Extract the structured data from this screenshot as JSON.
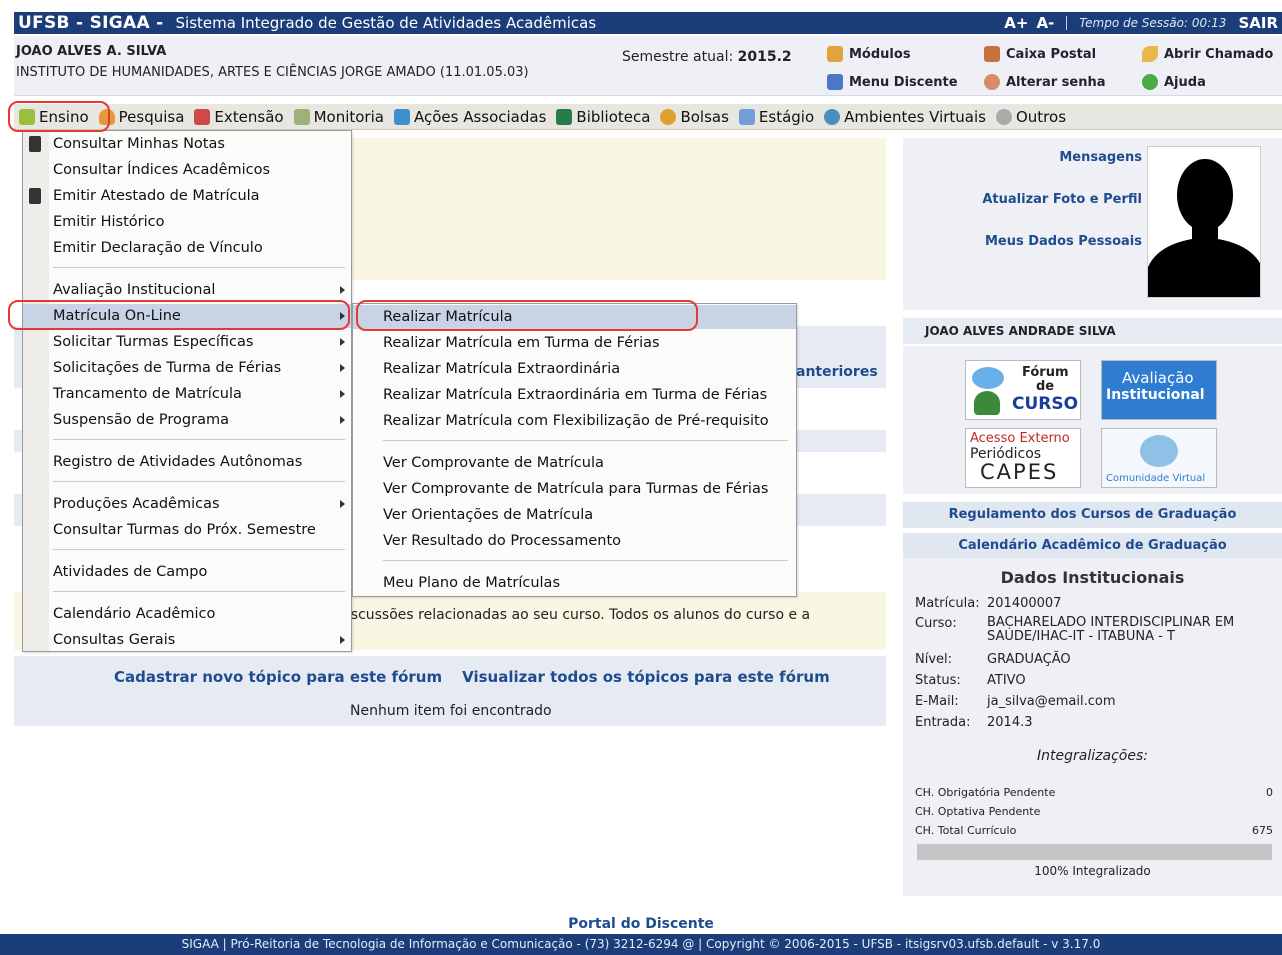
{
  "topbar": {
    "brand": "UFSB - SIGAA -",
    "system_name": "Sistema Integrado de Gestão de Atividades Acadêmicas",
    "font_increase": "A+",
    "font_decrease": "A-",
    "session_label": "Tempo de Sessão: 00:13",
    "logout": "SAIR"
  },
  "user": {
    "name": "JOAO ALVES A. SILVA",
    "institute": "INSTITUTO DE HUMANIDADES, ARTES E CIÊNCIAS JORGE AMADO (11.01.05.03)",
    "semester_label": "Semestre atual:",
    "semester_value": "2015.2"
  },
  "quicklinks": {
    "modulos": "Módulos",
    "caixa_postal": "Caixa Postal",
    "abrir_chamado": "Abrir Chamado",
    "menu_discente": "Menu Discente",
    "alterar_senha": "Alterar senha",
    "ajuda": "Ajuda"
  },
  "menubar": [
    "Ensino",
    "Pesquisa",
    "Extensão",
    "Monitoria",
    "Ações Associadas",
    "Biblioteca",
    "Bolsas",
    "Estágio",
    "Ambientes Virtuais",
    "Outros"
  ],
  "ensino_menu": [
    "Consultar Minhas Notas",
    "Consultar Índices Acadêmicos",
    "Emitir Atestado de Matrícula",
    "Emitir Histórico",
    "Emitir Declaração de Vínculo",
    "Avaliação Institucional",
    "Matrícula On-Line",
    "Solicitar Turmas Específicas",
    "Solicitações de Turma de Férias",
    "Trancamento de Matrícula",
    "Suspensão de Programa",
    "Registro de Atividades Autônomas",
    "Produções Acadêmicas",
    "Consultar Turmas do Próx. Semestre",
    "Atividades de Campo",
    "Calendário Acadêmico",
    "Consultas Gerais"
  ],
  "matricula_menu": [
    "Realizar Matrícula",
    "Realizar Matrícula em Turma de Férias",
    "Realizar Matrícula Extraordinária",
    "Realizar Matrícula Extraordinária em Turma de Férias",
    "Realizar Matrícula com Flexibilização de Pré-requisito",
    "Ver Comprovante de Matrícula",
    "Ver Comprovante de Matrícula para Turmas de Férias",
    "Ver Orientações de Matrícula",
    "Ver Resultado do Processamento",
    "Meu Plano de Matrículas"
  ],
  "main": {
    "anteriores": "anteriores",
    "forum_text": "discussões relacionadas ao seu curso. Todos os alunos do curso e a",
    "new_topic": "Cadastrar novo tópico para este fórum",
    "all_topics": "Visualizar todos os tópicos para este fórum",
    "empty": "Nenhum item foi encontrado"
  },
  "sidebar": {
    "mensagens": "Mensagens",
    "atualizar_foto": "Atualizar Foto e Perfil",
    "dados_pessoais": "Meus Dados Pessoais",
    "full_name": "JOAO ALVES ANDRADE SILVA",
    "tiles": {
      "forum_line1": "Fórum",
      "forum_line2": "de",
      "forum_line3": "CURSO",
      "avaliacao_line1": "Avaliação",
      "avaliacao_line2": "Institucional",
      "capes_line1": "Acesso Externo",
      "capes_line2": "Periódicos",
      "capes_line3": "CAPES",
      "comunidade": "Comunidade Virtual"
    },
    "regulamento": "Regulamento dos Cursos de Graduação",
    "calendario": "Calendário Acadêmico de Graduação",
    "dados_title": "Dados Institucionais",
    "matricula_k": "Matrícula:",
    "matricula_v": "201400007",
    "curso_k": "Curso:",
    "curso_v1": "BACHARELADO INTERDISCIPLINAR EM",
    "curso_v2": "SAÚDE/IHAC-IT - ITABUNA - T",
    "nivel_k": "Nível:",
    "nivel_v": "GRADUAÇÃO",
    "status_k": "Status:",
    "status_v": "ATIVO",
    "email_k": "E-Mail:",
    "email_v": "ja_silva@email.com",
    "entrada_k": "Entrada:",
    "entrada_v": "2014.3",
    "integralizacoes": "Integralizações:",
    "ch_obrig_k": "CH. Obrigatória Pendente",
    "ch_obrig_v": "0",
    "ch_opt_k": "CH. Optativa Pendente",
    "ch_total_k": "CH. Total Currículo",
    "ch_total_v": "675",
    "progress_fraction": 1.0,
    "progress_label": "100% Integralizado"
  },
  "footer": {
    "portal": "Portal do Discente",
    "text": "SIGAA | Pró-Reitoria de Tecnologia de Informação e Comunicação - (73) 3212-6294 @ | Copyright © 2006-2015 - UFSB - itsigsrv03.ufsb.default - v 3.17.0"
  }
}
